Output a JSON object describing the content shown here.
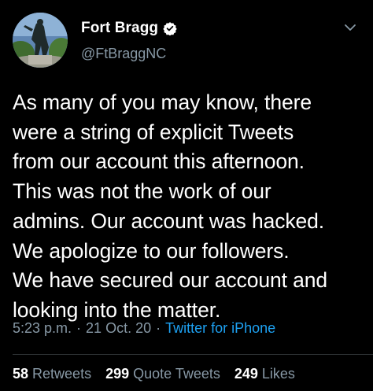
{
  "account": {
    "display_name": "Fort Bragg",
    "handle": "@FtBraggNC",
    "verified": true,
    "avatar_icon": "soldier-statue-avatar",
    "verified_icon": "verified-badge-icon",
    "menu_icon": "chevron-down-icon"
  },
  "tweet": {
    "text": "As many of you may know, there\nwere a string of explicit Tweets\nfrom our account this afternoon.\nThis was not the work of our\nadmins. Our account was hacked.\nWe apologize to our followers.\nWe have secured our account and\nlooking into the matter."
  },
  "meta": {
    "time": "5:23 p.m.",
    "separator": "·",
    "date": "21 Oct. 20",
    "source": "Twitter for iPhone"
  },
  "stats": {
    "retweets_count": "58",
    "retweets_label": "Retweets",
    "quote_tweets_count": "299",
    "quote_tweets_label": "Quote Tweets",
    "likes_count": "249",
    "likes_label": "Likes"
  },
  "colors": {
    "background": "#000000",
    "text_primary": "#ffffff",
    "text_secondary": "#8899a6",
    "link": "#1da1f2",
    "divider": "#2f3336"
  }
}
